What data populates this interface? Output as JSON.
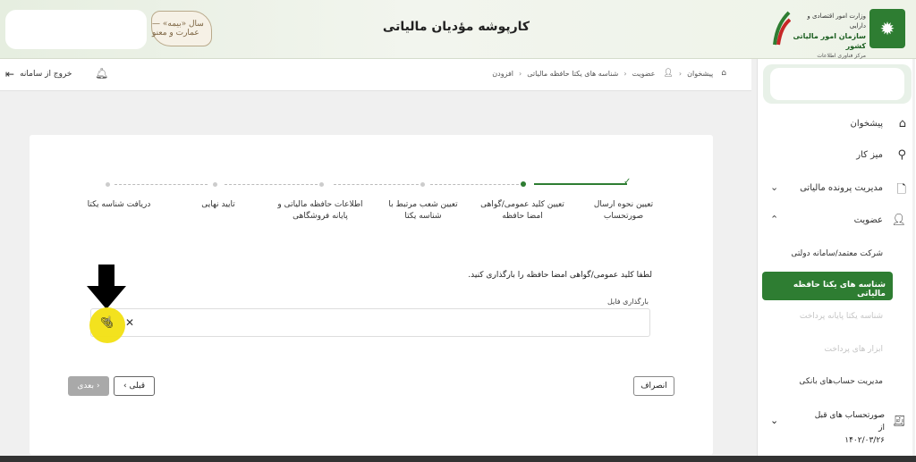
{
  "header": {
    "title": "کارپوشه مؤدیان مالیاتی",
    "logo_text": "سال «بیمه» — عمارت و معنو",
    "org_line1": "وزارت امور اقتصادی و دارایی",
    "org_line2": "سازمان امور مالیاتی کشور",
    "org_line3": "مرکز فناوری اطلاعات"
  },
  "navbar": {
    "logout_label": "خروج از سامانه",
    "breadcrumb": [
      "پیشخوان",
      "عضویت",
      "شناسه های یکتا حافظه مالیاتی",
      "افزودن"
    ]
  },
  "sidebar": {
    "items": [
      {
        "label": "پیشخوان",
        "icon": "home-icon"
      },
      {
        "label": "میز کار",
        "icon": "workdesk-icon"
      },
      {
        "label": "مدیریت پرونده مالیاتی",
        "icon": "file-icon"
      },
      {
        "label": "عضویت",
        "icon": "user-icon"
      }
    ],
    "sub_items": [
      {
        "label": "شرکت معتمد/سامانه دولتی",
        "state": "normal"
      },
      {
        "label": "شناسه های یکتا حافظه مالیاتی",
        "state": "active"
      },
      {
        "label": "شناسه یکتا پایانه پرداخت",
        "state": "disabled"
      },
      {
        "label": "ابزار های پرداخت",
        "state": "disabled"
      },
      {
        "label": "مدیریت حساب‌های بانکی",
        "state": "normal"
      }
    ],
    "last_item": {
      "line1": "صورتحساب های قبل از",
      "line2": "۱۴۰۲/۰۳/۲۶",
      "icon": "invoice-icon"
    }
  },
  "stepper": {
    "steps": [
      {
        "label": "تعیین نحوه ارسال صورتحساب",
        "state": "done"
      },
      {
        "label": "تعیین کلید عمومی/گواهی امضا حافظه",
        "state": "current"
      },
      {
        "label": "تعیین شعب مرتبط با شناسه یکتا",
        "state": "pending"
      },
      {
        "label": "اطلاعات حافظه مالیاتی و پایانه فروشگاهی",
        "state": "pending"
      },
      {
        "label": "تایید نهایی",
        "state": "pending"
      },
      {
        "label": "دریافت شناسه یکتا",
        "state": "pending"
      }
    ]
  },
  "form": {
    "prompt": "لطفا کلید عمومی/گواهی امضا حافظه را بارگذاری کنید.",
    "upload_label": "بارگذاری فایل"
  },
  "buttons": {
    "cancel": "انصراف",
    "prev": "قبلی",
    "next": "بعدی"
  },
  "colors": {
    "accent": "#2e7d32",
    "disabled_button": "#a9a9a9",
    "highlight": "#f2e012"
  }
}
